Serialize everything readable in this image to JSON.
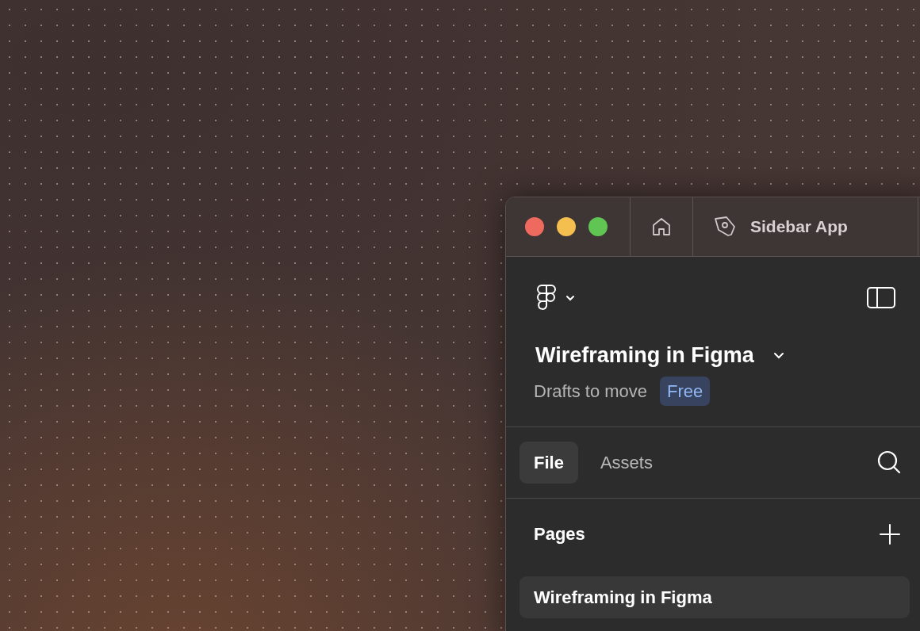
{
  "title_bar": {
    "tab_title": "Sidebar App"
  },
  "file": {
    "title": "Wireframing in Figma",
    "location": "Drafts to move",
    "plan": "Free"
  },
  "tabs": [
    {
      "label": "File",
      "selected": true
    },
    {
      "label": "Assets",
      "selected": false
    }
  ],
  "pages": {
    "heading": "Pages",
    "items": [
      {
        "label": "Wireframing in Figma",
        "selected": true
      }
    ]
  }
}
